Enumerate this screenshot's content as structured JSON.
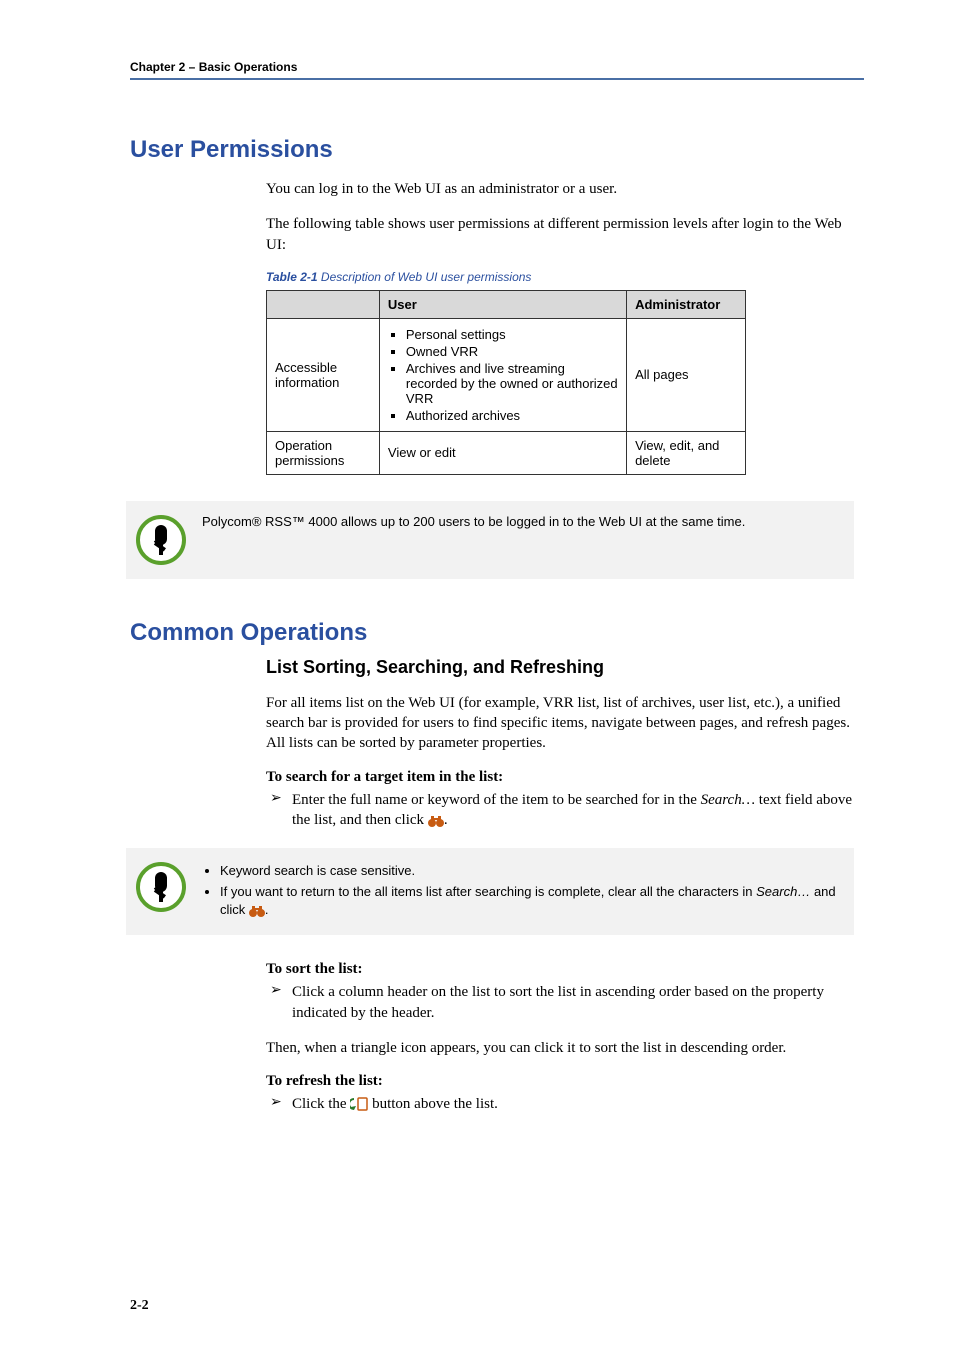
{
  "header": {
    "chapter": "Chapter 2 – Basic Operations"
  },
  "sections": {
    "user_permissions": {
      "title": "User Permissions",
      "intro1": "You can log in to the Web UI as an administrator or a user.",
      "intro2": "The following table shows user permissions at different permission levels after login to the Web UI:",
      "table_caption_label": "Table 2-1",
      "table_caption_text": " Description of Web UI user permissions",
      "table": {
        "headers": {
          "col1": "",
          "col2": "User",
          "col3": "Administrator"
        },
        "rows": [
          {
            "label": "Accessible information",
            "user_items": [
              "Personal settings",
              "Owned VRR",
              "Archives and live streaming recorded by the owned or authorized VRR",
              "Authorized archives"
            ],
            "admin": "All pages"
          },
          {
            "label": "Operation permissions",
            "user_text": "View or edit",
            "admin": "View, edit, and delete"
          }
        ]
      },
      "note": "Polycom® RSS™ 4000 allows up to 200 users to be logged in to the Web UI at the same time."
    },
    "common_operations": {
      "title": "Common Operations",
      "sub1": {
        "title": "List Sorting, Searching, and Refreshing",
        "para": "For all items list on the Web UI (for example, VRR list, list of archives, user list, etc.), a unified search bar is provided for users to find specific items, navigate between pages, and refresh pages. All lists can be sorted by parameter properties.",
        "search_head": "To search for a target item in the list:",
        "search_step_a": "Enter the full name or keyword of the item to be searched for in the ",
        "search_step_italic": "Search…",
        "search_step_b": " text field above the list, and then click ",
        "note_items": {
          "a": "Keyword search is case sensitive.",
          "b_a": "If you want to return to the all items list after searching is complete, clear all the characters in ",
          "b_italic": "Search…",
          "b_b": " and click "
        },
        "sort_head": "To sort the list:",
        "sort_step": "Click a column header on the list to sort the list in ascending order based on the property indicated by the header.",
        "sort_para": "Then, when a triangle icon appears, you can click it to sort the list in descending order.",
        "refresh_head": "To refresh the list:",
        "refresh_step_a": "Click the ",
        "refresh_step_b": " button above the list."
      }
    }
  },
  "footer": {
    "page": "2-2"
  }
}
